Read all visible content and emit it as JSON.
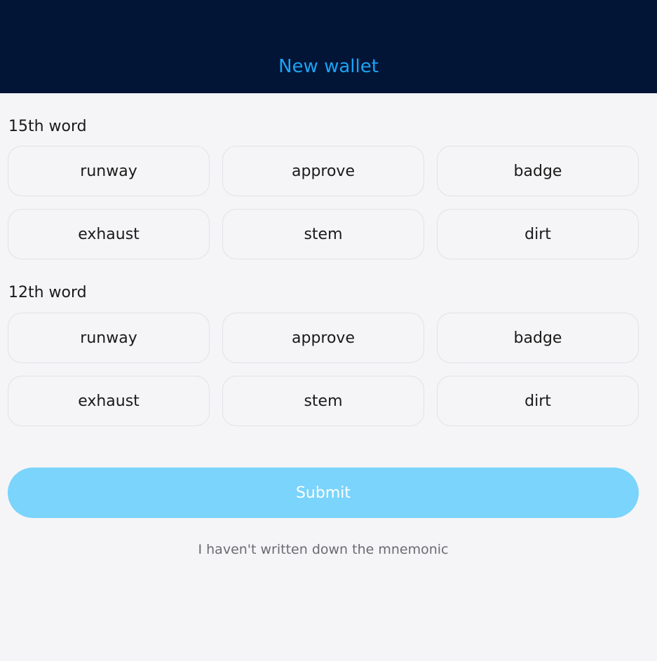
{
  "header": {
    "title": "New wallet"
  },
  "questions": [
    {
      "label": "15th word",
      "options": [
        "runway",
        "approve",
        "badge",
        "exhaust",
        "stem",
        "dirt"
      ]
    },
    {
      "label": "12th word",
      "options": [
        "runway",
        "approve",
        "badge",
        "exhaust",
        "stem",
        "dirt"
      ]
    }
  ],
  "actions": {
    "submit_label": "Submit",
    "skip_label": "I haven't written down the mnemonic"
  },
  "colors": {
    "header_bg": "#021537",
    "title": "#1aa3f5",
    "submit_bg": "#7ad4fb",
    "page_bg": "#f5f5f7"
  }
}
